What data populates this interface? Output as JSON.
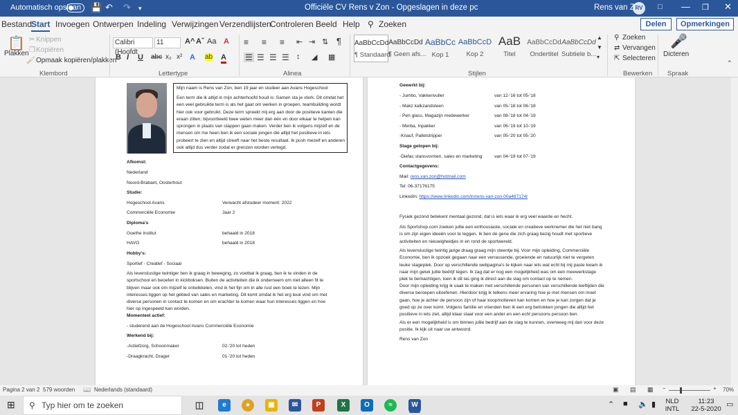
{
  "titlebar": {
    "autosave": "Automatisch opslaan",
    "doc_title": "Officiële CV Rens v Zon  -  Opgeslagen in deze pc",
    "user": "Rens van Zon",
    "initials": "RV"
  },
  "tabs": [
    "Bestand",
    "Start",
    "Invoegen",
    "Ontwerpen",
    "Indeling",
    "Verwijzingen",
    "Verzendlijsten",
    "Controleren",
    "Beeld",
    "Help",
    "Zoeken"
  ],
  "share": "Delen",
  "comments": "Opmerkingen",
  "ribbon": {
    "clipboard": {
      "paste": "Plakken",
      "cut": "Knippen",
      "copy": "Kopiëren",
      "painter": "Opmaak kopiëren/plakken",
      "label": "Klembord"
    },
    "font": {
      "name": "Calibri (Hoofdt",
      "size": "11",
      "label": "Lettertype",
      "bold": "B",
      "italic": "I",
      "underline": "U",
      "strike": "abc",
      "sub": "x₂",
      "sup": "x²",
      "grow": "A^",
      "shrink": "Aˇ",
      "case": "Aa",
      "clear": "A",
      "effects": "A",
      "highlight": "ab",
      "color": "A"
    },
    "paragraph": {
      "label": "Alinea",
      "pilcrow": "¶"
    },
    "styles": {
      "label": "Stijlen",
      "items": [
        {
          "preview": "AaBbCcDd",
          "name": "¶ Standaard"
        },
        {
          "preview": "AaBbCcDd",
          "name": "¶ Geen afs..."
        },
        {
          "preview": "AaBbCc",
          "name": "Kop 1"
        },
        {
          "preview": "AaBbCcD",
          "name": "Kop 2"
        },
        {
          "preview": "AaB",
          "name": "Titel"
        },
        {
          "preview": "AaBbCcDd",
          "name": "Ondertitel"
        },
        {
          "preview": "AaBbCcDd",
          "name": "Subtiele b..."
        }
      ]
    },
    "editing": {
      "label": "Bewerken",
      "find": "Zoeken",
      "replace": "Vervangen",
      "select": "Selecteren"
    },
    "voice": {
      "label": "Spraak",
      "dictate": "Dicteren"
    }
  },
  "page1": {
    "intro_title": "Mijn naam is Rens van Zon, ben 19 jaar en studeer aan Avans Hogeschool",
    "intro_body": "Een term die ik altijd in mijn achterhoofd houd is: Samen sta je sterk. Dit omdat het een veel gebruikte term is als het gaat om werken in groepen, teambuilding wordt hier ook voor gebruikt. Deze term spreekt mij erg aan door de positieve kanten die eraan zitten; bijvoorbeeld twee weten meer dan één en door elkaar te helpen kan sprongen in plaats van stappen gaan maken. Verder ben ik volgens mijzelf en de mensen om me heen ben ik een sociale jongen die altijd het positieve in iets probeert te zien en altijd streeft naar het beste resultaat. Ik push mezelf en anderen ook altijd dus verder zodat er grenzen worden verlegd.",
    "afkomst_h": "Afkomst:",
    "afkomst": [
      "Nederland",
      "Noord-Brabant, Oosterhout"
    ],
    "studie_h": "Studie:",
    "studie": [
      {
        "a": "Hogeschool Avans",
        "b": "Verwacht afstudeer moment: 2022"
      },
      {
        "a": "Commerciële Economie",
        "b": "Jaar 2"
      }
    ],
    "diploma_h": "Diploma's",
    "diploma": [
      {
        "a": "Goethe institut",
        "b": "behaald in 2018"
      },
      {
        "a": "HAVO",
        "b": "behaald in 2018"
      }
    ],
    "hobby_h": "Hobby's:",
    "hobby": "Sportief - Creatief - Sociaal",
    "hobby_text": "Als levenslustige twintiger ben ik graag in beweging, zo voetbal ik graag, ben ik te vinden in de sportschool en beoefen in kickboksen. Buiten de activiteiten die ik onderneem om niet alleen fit te blijven maar ook om mijzelf te ontwikkelen, vind ik het fijn om in alle rust een boek te lezen. Mijn interesses liggen op het gebied van sales en marketing. Dit komt omdat ik het erg leuk vind om met diverse personen in contact te komen en om erachter te komen waar hun interesses liggen en hoe hier op ingespeeld kan worden.",
    "moment_h": "Momenteel actief:",
    "moment": "- studerend aan de Hogeschool Avans Commerciële Economie",
    "werkend_h": "Werkend bij:",
    "werkend": [
      {
        "a": "-Actiefzorg, Schoonmaker",
        "b": "02-'20 tot heden"
      },
      {
        "a": "-Draagkracht, Drager",
        "b": "01-'20 tot heden"
      }
    ]
  },
  "page2": {
    "gewerkt_h": "Gewerkt bij:",
    "gewerkt": [
      {
        "a": "- Jumbo, Vakkenvuller",
        "b": "van 12-'16 tot 05-'18"
      },
      {
        "a": "- Makz kalkzandsteen",
        "b": "van 05-'18 tot 06-'18"
      },
      {
        "a": "- Peri glass, Magazijn medewerker",
        "b": "van 08-'18 tot 04-'19"
      },
      {
        "a": "- Merba, Inpakker",
        "b": "van 06-'19 tot 10-'19"
      },
      {
        "a": "-Knauf, Palletstripper",
        "b": "van 05-'20 tot 05-'20"
      }
    ],
    "stage_h": "Stage gelopen bij:",
    "stage": {
      "a": "-Diefac stansvormen, sales en marketing",
      "b": "van 04-'19 tot 07-'19"
    },
    "contact_h": "Contactgegevens:",
    "mail_label": "Mail: ",
    "mail": "rens.van.zon@hotmail.com",
    "tel": "Tel: 06-37176175",
    "linkedin_label": "LinkedIn: ",
    "linkedin": "https://www.linkedin.com/in/rens-van-zon-00a487174/",
    "p1": "Fysiek gezond betekent mentaal gezond, dat is iets waar ik erg veel waarde en hecht.",
    "p2": "Als Sportshop.com zoeken jullie een enthousiaste, sociale en creatieve werknemer die het niet bang is om zijn eigen ideeën voor te leggen. Ik ben de gene die zich graag bezig houdt met sportieve activiteiten en nieuwigheidjes in en rond de sportwereld.",
    "p3": "Als levenslustige twintig jarige draag graag mijn steentje bij. Voor mijn opleiding, Commerciële Economie, ben ik opzoek gegaan naar een verrassende, groeiende en natuurlijk niet te vergeten leuke stageplek. Door op verschillende webpagina's te kijken naar iets wat echt bij mij paste kwam ik naar mijn geluk jullie bedrijf tegen. Ik zag dat er nog een mogelijkheid was om een meewerkstage plek te bemachtigen, toen ik dit las ging ik direct aan de slag om contact op te nemen.",
    "p4": "Door mijn opleiding krijg ik vaak te maken met verschillende personen van verschillende leeftijden die diverse beroepen uitoefenen. Hierdoor krijg ik telkens meer ervaring hoe je met mensen om moet gaan, hoe je achter de persoon zijn of haar koopmotieven kan komen en hoe je kan zorgen dat je goed op ze over komt. Volgens familie en vrienden ben ik een erg betrokken jongen die altijd het positieve in iets ziet, altijd klaar staat voor een ander en een echt persoons persoon ben.",
    "p5": "Als er een mogelijkheid is om binnen jullie bedrijf aan de slag te kunnen, overweeg mij dan voor deze positie. Ik kijk uit naar uw antwoord.",
    "sign": "Rens van Zon"
  },
  "status": {
    "page": "Pagina 2 van 2",
    "words": "579 woorden",
    "lang": "Nederlands (standaard)",
    "zoom": "70%"
  },
  "taskbar": {
    "search": "Typ hier om te zoeken",
    "lang1": "NLD",
    "lang2": "INTL",
    "time": "11:23",
    "date": "22-5-2020"
  }
}
